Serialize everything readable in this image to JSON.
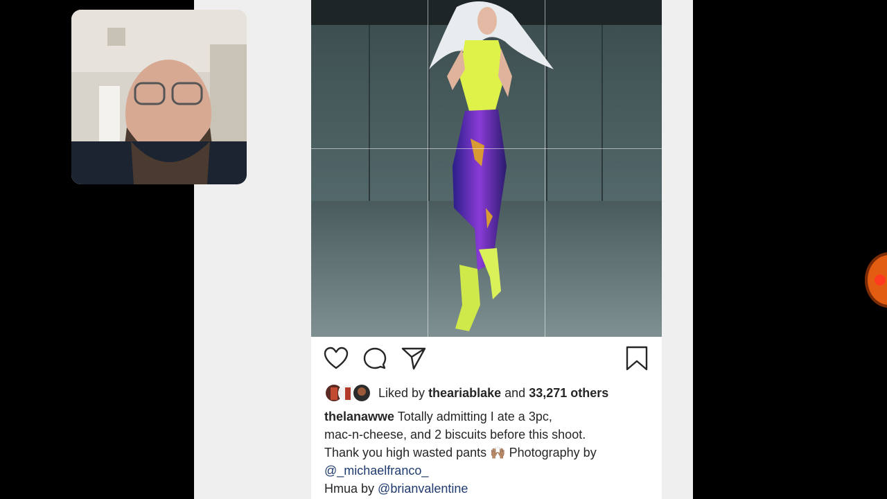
{
  "post": {
    "action_icons": [
      "heart-icon",
      "comment-icon",
      "share-icon",
      "bookmark-icon"
    ],
    "liked_by_prefix": "Liked by",
    "liked_by_user": "theariablake",
    "and_text": "and",
    "others_text": "33,271 others",
    "caption": {
      "username": "thelanawwe",
      "line1": "Totally admitting I ate a 3pc,",
      "line2": "mac-n-cheese, and 2 biscuits before this shoot.",
      "line3_text": "Thank you high wasted pants",
      "line3_emoji": "🙌🏽",
      "line3_after": "Photography by",
      "mention1": "@_michaelfranco_",
      "line5_prefix": "Hmua by",
      "mention2": "@brianvalentine"
    }
  },
  "colors": {
    "background": "#000000",
    "page": "#efefef",
    "post": "#ffffff",
    "text": "#262626",
    "mention": "#1f3a6e",
    "record": "#e25c12"
  }
}
